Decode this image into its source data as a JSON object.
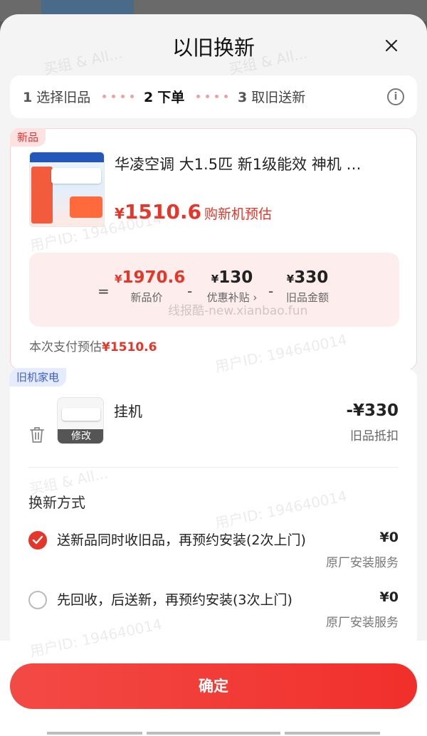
{
  "title": "以旧换新",
  "steps": [
    {
      "num": "1",
      "label": "选择旧品"
    },
    {
      "num": "2",
      "label": "下单"
    },
    {
      "num": "3",
      "label": "取旧送新"
    }
  ],
  "new_card": {
    "tag": "新品",
    "product_name": "华凌空调 大1.5匹 新1级能效 神机 …",
    "price_symbol": "¥",
    "price": "1510.6",
    "price_note": "购新机预估",
    "calc": {
      "equals": "=",
      "minus1": "-",
      "minus2": "-",
      "new_price": {
        "yen": "¥",
        "value": "1970.6",
        "label": "新品价"
      },
      "subsidy": {
        "yen": "¥",
        "value": "130",
        "label": "优惠补贴 ›"
      },
      "old_value": {
        "yen": "¥",
        "value": "330",
        "label": "旧品金额"
      }
    },
    "pay_label": "本次支付预估",
    "pay_value": "¥1510.6"
  },
  "old_card": {
    "tag": "旧机家电",
    "item_name": "挂机",
    "edit_label": "修改",
    "price": "-¥330",
    "price_label": "旧品抵扣",
    "method_title": "换新方式",
    "options": [
      {
        "label": "送新品同时收旧品，再预约安装(2次上门)",
        "price": "¥0",
        "sub": "原厂安装服务",
        "selected": true
      },
      {
        "label": "先回收，后送新，再预约安装(3次上门)",
        "price": "¥0",
        "sub": "原厂安装服务",
        "selected": false
      }
    ]
  },
  "confirm_label": "确定",
  "watermark": {
    "user": "用户ID: 194640014",
    "group": "买组 & All...",
    "url": "线报酷-new.xianbao.fun"
  },
  "colors": {
    "accent": "#e5362a",
    "button": "#f2403c"
  }
}
